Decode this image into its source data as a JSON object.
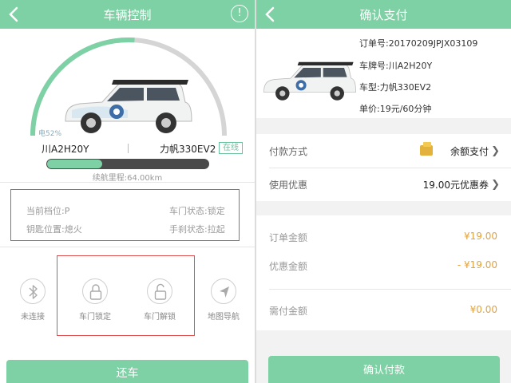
{
  "colors": {
    "accent": "#7ed1a4",
    "highlight_box": "#e05050",
    "amount": "#e3a33c",
    "coin": "#e3b23c"
  },
  "left": {
    "header": {
      "title": "车辆控制",
      "info_icon": "info-icon"
    },
    "battery": {
      "level_text": "电52%",
      "level": 0.52
    },
    "car": {
      "plate": "川A2H20Y",
      "model": "力帆330EV2",
      "status_badge": "在线"
    },
    "range": {
      "text": "续航里程:64.00km",
      "fill": 0.34
    },
    "status": {
      "gear": "当前档位:P",
      "door": "车门状态:锁定",
      "key": "钥匙位置:熄火",
      "handbrake": "手刹状态:拉起"
    },
    "controls": [
      {
        "label": "未连接",
        "icon": "bluetooth-icon"
      },
      {
        "label": "车门锁定",
        "icon": "lock-icon"
      },
      {
        "label": "车门解锁",
        "icon": "unlock-icon"
      },
      {
        "label": "地图导航",
        "icon": "navigation-arrow-icon"
      }
    ],
    "return_button": "还车"
  },
  "right": {
    "header": {
      "title": "确认支付",
      "back_icon": "back-chevron-icon"
    },
    "order": {
      "order_no": "订单号:20170209JPJX03109",
      "plate": "车牌号:川A2H20Y",
      "model": "车型:力帆330EV2",
      "price": "单价:19元/60分钟"
    },
    "payment_method": {
      "label": "付款方式",
      "value": "余额支付",
      "icon": "wallet-coin-icon"
    },
    "discount": {
      "label": "使用优惠",
      "value": "19.00元优惠券"
    },
    "amounts": {
      "order_total": {
        "label": "订单金额",
        "value": "¥19.00"
      },
      "discount_total": {
        "label": "优惠金额",
        "value": "- ¥19.00"
      },
      "due": {
        "label": "需付金额",
        "value": "¥0.00"
      }
    },
    "confirm_button": "确认付款"
  }
}
